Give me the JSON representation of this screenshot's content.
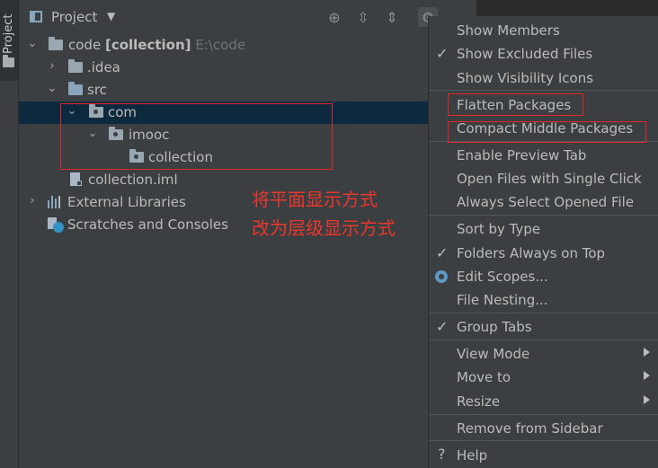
{
  "strip": {
    "label": "Project"
  },
  "header": {
    "title": "Project"
  },
  "tree": {
    "root": {
      "name": "code",
      "module": "[collection]",
      "path": "E:\\code"
    },
    "idea": ".idea",
    "src": "src",
    "com": "com",
    "imooc": "imooc",
    "collection": "collection",
    "iml": "collection.iml",
    "libs": "External Libraries",
    "scratches": "Scratches and Consoles"
  },
  "annotation": {
    "line1": "将平面显示方式",
    "line2": "改为层级显示方式"
  },
  "menu": {
    "show_members": "Show Members",
    "show_excluded": "Show Excluded Files",
    "show_visibility": "Show Visibility Icons",
    "flatten_packages": "Flatten Packages",
    "compact_middle": "Compact Middle Packages",
    "enable_preview": "Enable Preview Tab",
    "open_single_click": "Open Files with Single Click",
    "always_select": "Always Select Opened File",
    "sort_by_type": "Sort by Type",
    "folders_top": "Folders Always on Top",
    "edit_scopes": "Edit Scopes...",
    "file_nesting": "File Nesting...",
    "group_tabs": "Group Tabs",
    "view_mode": "View Mode",
    "move_to": "Move to",
    "resize": "Resize",
    "remove_sidebar": "Remove from Sidebar",
    "help": "Help",
    "checked": {
      "show_excluded": true,
      "folders_top": true,
      "group_tabs": true,
      "edit_scopes_radio": true
    }
  },
  "colors": {
    "annotation": "#e8372d",
    "selection": "#0d293e",
    "folder": "#8aa4bb"
  }
}
